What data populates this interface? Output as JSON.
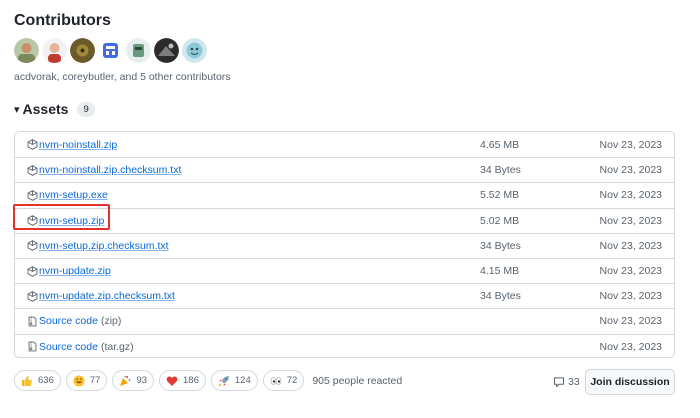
{
  "contributors": {
    "title": "Contributors",
    "summary": "acdvorak, coreybutler, and 5 other contributors",
    "avatars": [
      "avatar-1",
      "avatar-2",
      "avatar-3",
      "avatar-4",
      "avatar-5",
      "avatar-6",
      "avatar-7"
    ]
  },
  "assets": {
    "title": "Assets",
    "count": "9",
    "items": [
      {
        "name": "nvm-noinstall.zip",
        "size": "4.65 MB",
        "date": "Nov 23, 2023",
        "icon": "package-icon"
      },
      {
        "name": "nvm-noinstall.zip.checksum.txt",
        "size": "34 Bytes",
        "date": "Nov 23, 2023",
        "icon": "package-icon"
      },
      {
        "name": "nvm-setup.exe",
        "size": "5.52 MB",
        "date": "Nov 23, 2023",
        "icon": "package-icon"
      },
      {
        "name": "nvm-setup.zip",
        "size": "5.02 MB",
        "date": "Nov 23, 2023",
        "icon": "package-icon"
      },
      {
        "name": "nvm-setup.zip.checksum.txt",
        "size": "34 Bytes",
        "date": "Nov 23, 2023",
        "icon": "package-icon"
      },
      {
        "name": "nvm-update.zip",
        "size": "4.15 MB",
        "date": "Nov 23, 2023",
        "icon": "package-icon"
      },
      {
        "name": "nvm-update.zip.checksum.txt",
        "size": "34 Bytes",
        "date": "Nov 23, 2023",
        "icon": "package-icon"
      },
      {
        "name": "Source code",
        "sub": "(zip)",
        "size": "",
        "date": "Nov 23, 2023",
        "icon": "file-zip-icon"
      },
      {
        "name": "Source code",
        "sub": "(tar.gz)",
        "size": "",
        "date": "Nov 23, 2023",
        "icon": "file-zip-icon"
      }
    ]
  },
  "reactions": {
    "items": [
      {
        "emoji": "thumbs-up-icon",
        "count": "636"
      },
      {
        "emoji": "laugh-icon",
        "count": "77"
      },
      {
        "emoji": "hooray-icon",
        "count": "93"
      },
      {
        "emoji": "heart-icon",
        "count": "186"
      },
      {
        "emoji": "rocket-icon",
        "count": "124"
      },
      {
        "emoji": "eyes-icon",
        "count": "72"
      }
    ],
    "summary": "905 people reacted"
  },
  "discussion": {
    "comment_count": "33",
    "join_label": "Join discussion"
  },
  "colors": {
    "link": "#0969da",
    "muted": "#59636e",
    "border": "#d1d9e0",
    "highlight": "#e5322d"
  }
}
